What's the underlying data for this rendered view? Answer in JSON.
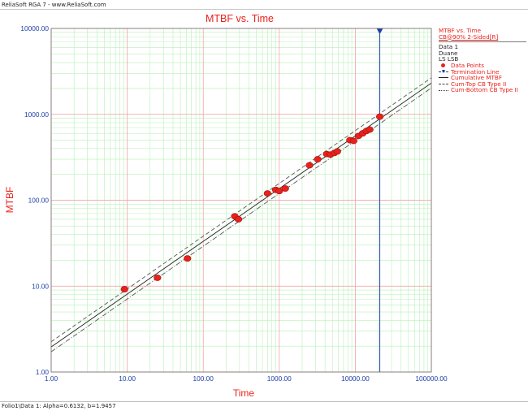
{
  "app_title": "ReliaSoft RGA 7 - www.ReliaSoft.com",
  "status_text": "Folio1\\Data 1: Alpha=0.6132, b=1.9457",
  "legend": {
    "title": "MTBF vs. Time",
    "subtitle": "CB@90% 2-Sided[R]",
    "dataset": "Data 1",
    "user": "Duane",
    "method": "LS LSB",
    "items": [
      {
        "label": "Data Points",
        "swatch": "dot"
      },
      {
        "label": "Termination Line",
        "swatch": "term"
      },
      {
        "label": "Cumulative MTBF",
        "swatch": "solid"
      },
      {
        "label": "Cum-Top CB Type II",
        "swatch": "dash"
      },
      {
        "label": "Cum-Bottom CB Type II",
        "swatch": "dashdot"
      }
    ]
  },
  "colors": {
    "title": "#e8221b",
    "axis_label": "#e8221b",
    "tick_label": "#1f3fa8",
    "points": "#e8221b",
    "termination": "#1f3fa8",
    "minor_grid": "#b8f0b8",
    "major_grid": "#ee9a9a"
  },
  "chart_data": {
    "type": "scatter",
    "title": "MTBF vs. Time",
    "xlabel": "Time",
    "ylabel": "MTBF",
    "x_scale": "log",
    "y_scale": "log",
    "xlim": [
      1,
      100000
    ],
    "ylim": [
      1,
      10000
    ],
    "x_ticks": [
      1,
      10,
      100,
      1000,
      10000,
      100000
    ],
    "x_tick_labels": [
      "1.00",
      "10.00",
      "100.00",
      "1000.00",
      "10000.00",
      "100000.00"
    ],
    "y_ticks": [
      1,
      10,
      100,
      1000,
      10000
    ],
    "y_tick_labels": [
      "1.00",
      "10.00",
      "100.00",
      "1000.00",
      "10000.00"
    ],
    "grid": true,
    "legend_position": "right",
    "series": [
      {
        "name": "Data Points",
        "type": "scatter",
        "x": [
          9.2,
          25,
          62,
          260,
          290,
          700,
          900,
          1000,
          1200,
          2500,
          3200,
          4200,
          4700,
          5300,
          5800,
          8500,
          9500,
          11000,
          12500,
          14000,
          15500,
          21000
        ],
        "y": [
          9.2,
          12.5,
          21,
          65,
          60,
          120,
          132,
          128,
          137,
          255,
          300,
          345,
          340,
          355,
          370,
          500,
          490,
          560,
          600,
          640,
          665,
          940
        ]
      },
      {
        "name": "Cumulative MTBF",
        "type": "line",
        "style": "solid",
        "x": [
          1,
          100000
        ],
        "y": [
          1.96,
          2310
        ]
      },
      {
        "name": "Cum-Top CB Type II",
        "type": "line",
        "style": "dash",
        "x": [
          1,
          100000
        ],
        "y": [
          2.25,
          2660
        ]
      },
      {
        "name": "Cum-Bottom CB Type II",
        "type": "line",
        "style": "dashdot",
        "x": [
          1,
          100000
        ],
        "y": [
          1.72,
          2030
        ]
      },
      {
        "name": "Termination Line",
        "type": "vline",
        "x": 21000
      }
    ]
  }
}
